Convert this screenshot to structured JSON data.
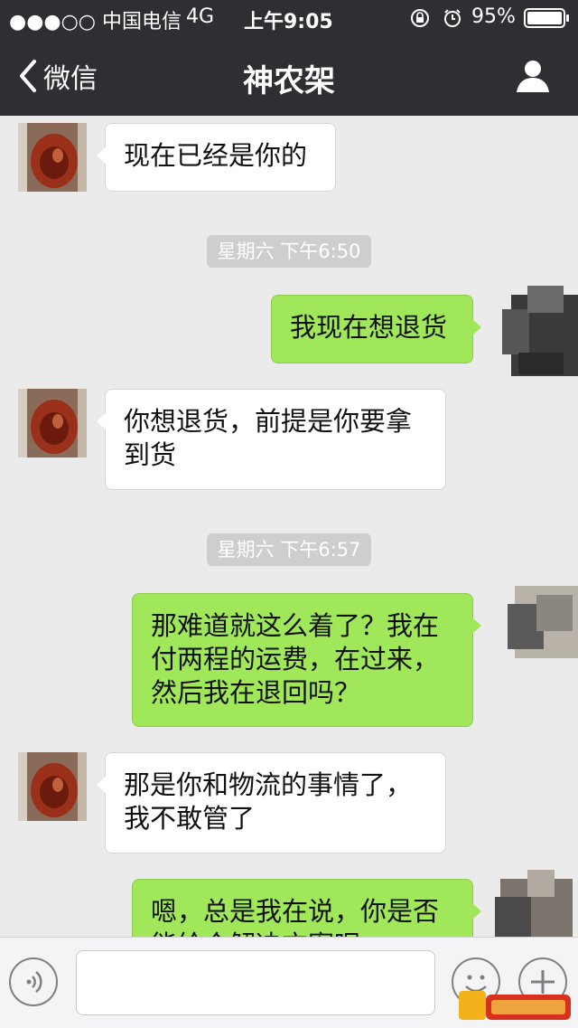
{
  "status_bar": {
    "carrier": "●●●○○ 中国电信",
    "network": "4G",
    "time": "上午9:05",
    "battery": "95%"
  },
  "nav": {
    "back_label": "微信",
    "title": "神农架",
    "profile_icon": "person-icon"
  },
  "messages": [
    {
      "side": "left",
      "text": "现在已经是你的"
    },
    {
      "type": "timestamp",
      "text": "星期六 下午6:50"
    },
    {
      "side": "right",
      "text": "我现在想退货"
    },
    {
      "side": "left",
      "text": "你想退货，前提是你要拿\n到货"
    },
    {
      "type": "timestamp",
      "text": "星期六 下午6:57"
    },
    {
      "side": "right",
      "text": "那难道就这么着了？我在\n付两程的运费，在过来，\n然后我在退回吗？"
    },
    {
      "side": "left",
      "text": "那是你和物流的事情了，\n我不敢管了"
    },
    {
      "side": "right",
      "text": "嗯，总是我在说，你是否\n能给个解决方案呢"
    }
  ],
  "input_bar": {
    "voice_icon": "voice-icon",
    "emoji_icon": "emoji-icon",
    "plus_icon": "plus-icon",
    "input_value": ""
  },
  "colors": {
    "header": "#2e2f33",
    "chat_bg": "#ebebeb",
    "bubble_me": "#a0e75a",
    "bubble_other": "#ffffff"
  }
}
